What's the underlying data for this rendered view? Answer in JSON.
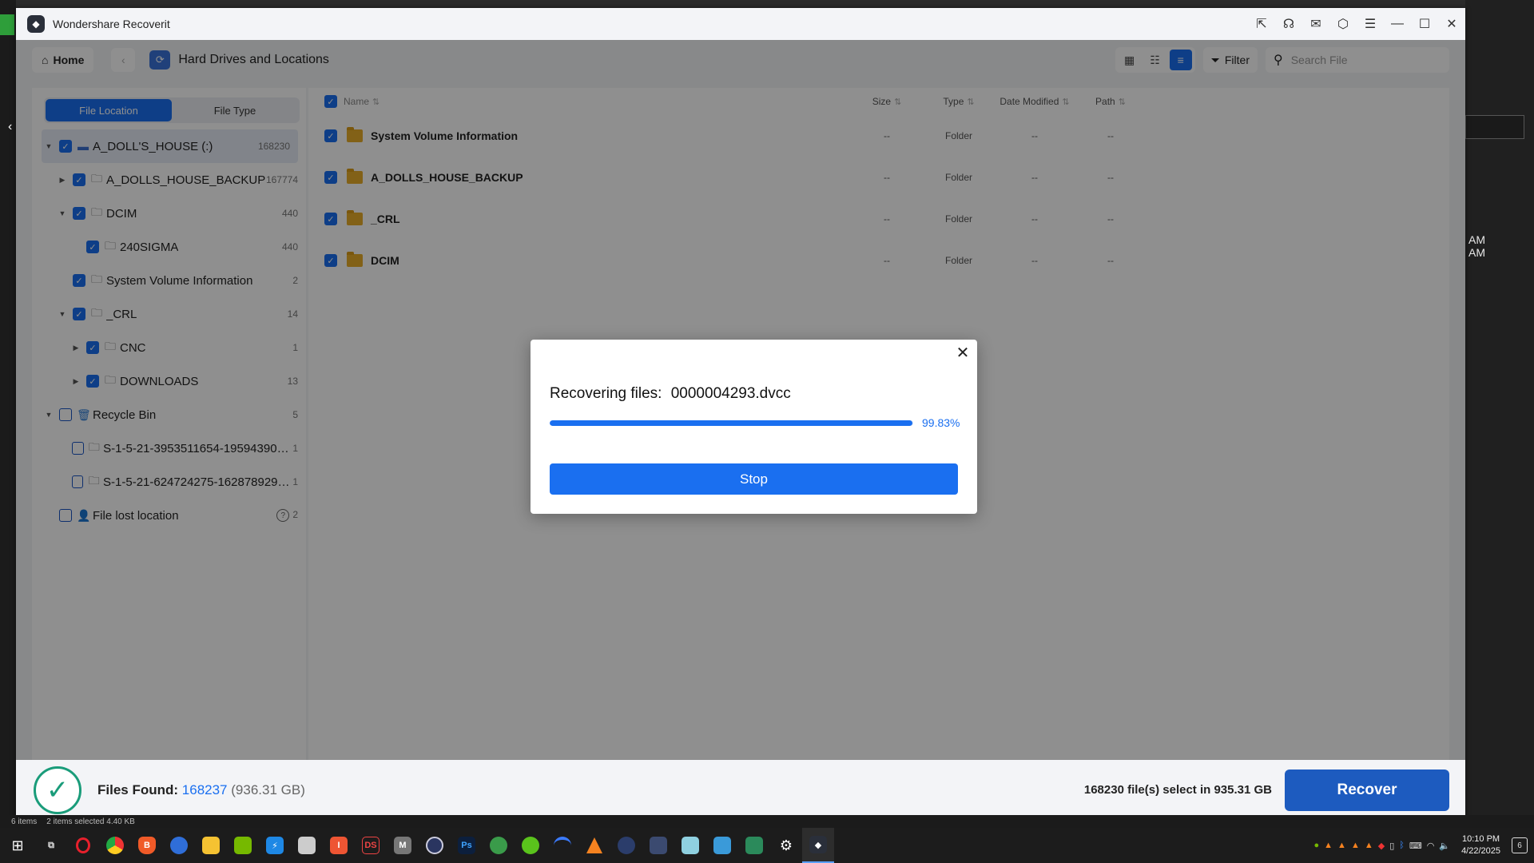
{
  "app": {
    "title": "Wondershare Recoverit",
    "title_icons": [
      "export-icon",
      "headset-icon",
      "mail-icon",
      "cube-icon",
      "menu-icon"
    ],
    "window_controls": [
      "minimize-icon",
      "maximize-icon",
      "close-icon"
    ]
  },
  "nav": {
    "home_label": "Home",
    "location_title": "Hard Drives and Locations",
    "filter_label": "Filter",
    "search_placeholder": "Search File"
  },
  "left": {
    "tabs": [
      {
        "label": "File Location",
        "active": true
      },
      {
        "label": "File Type",
        "active": false
      }
    ],
    "tree": [
      {
        "label": "A_DOLL'S_HOUSE (:)",
        "count": "168230",
        "level": 0,
        "caret": "down",
        "checked": true,
        "icon": "drive-icon",
        "selected": true
      },
      {
        "label": "A_DOLLS_HOUSE_BACKUP",
        "count": "167774",
        "level": 1,
        "caret": "right",
        "checked": true,
        "icon": "folder-icon"
      },
      {
        "label": "DCIM",
        "count": "440",
        "level": 1,
        "caret": "down",
        "checked": true,
        "icon": "folder-icon"
      },
      {
        "label": "240SIGMA",
        "count": "440",
        "level": 2,
        "caret": "",
        "checked": true,
        "icon": "folder-icon"
      },
      {
        "label": "System Volume Information",
        "count": "2",
        "level": 1,
        "caret": "",
        "checked": true,
        "icon": "folder-icon"
      },
      {
        "label": "_CRL",
        "count": "14",
        "level": 1,
        "caret": "down",
        "checked": true,
        "icon": "folder-icon"
      },
      {
        "label": "CNC",
        "count": "1",
        "level": 2,
        "caret": "right",
        "checked": true,
        "icon": "folder-icon"
      },
      {
        "label": "DOWNLOADS",
        "count": "13",
        "level": 2,
        "caret": "right",
        "checked": true,
        "icon": "folder-icon"
      },
      {
        "label": "Recycle Bin",
        "count": "5",
        "level": 0,
        "caret": "down",
        "checked": false,
        "icon": "recycle-bin-icon"
      },
      {
        "label": "S-1-5-21-3953511654-1959439042-4...",
        "count": "1",
        "level": 1,
        "caret": "",
        "checked": false,
        "icon": "folder-icon"
      },
      {
        "label": "S-1-5-21-624724275-1628789295-34...",
        "count": "1",
        "level": 1,
        "caret": "",
        "checked": false,
        "icon": "folder-icon"
      },
      {
        "label": "File lost location",
        "count": "2",
        "level": 0,
        "caret": "",
        "checked": false,
        "icon": "user-location-icon",
        "help": true
      }
    ]
  },
  "table": {
    "columns": [
      "Name",
      "Size",
      "Type",
      "Date Modified",
      "Path"
    ],
    "rows": [
      {
        "name": "System Volume Information",
        "size": "--",
        "type": "Folder",
        "date": "--",
        "path": "--"
      },
      {
        "name": "A_DOLLS_HOUSE_BACKUP",
        "size": "--",
        "type": "Folder",
        "date": "--",
        "path": "--"
      },
      {
        "name": "_CRL",
        "size": "--",
        "type": "Folder",
        "date": "--",
        "path": "--"
      },
      {
        "name": "DCIM",
        "size": "--",
        "type": "Folder",
        "date": "--",
        "path": "--"
      }
    ]
  },
  "bottom": {
    "found_label": "Files Found:",
    "found_count": "168237",
    "found_size": "(936.31 GB)",
    "selection": "168230 file(s) select in 935.31 GB",
    "recover_label": "Recover"
  },
  "modal": {
    "heading": "Recovering files:",
    "file": "0000004293.dvcc",
    "progress": 0.9983,
    "percent": "99.83%",
    "stop_label": "Stop"
  },
  "desktop": {
    "am1": "AM",
    "am2": "AM",
    "status_items": "6 items",
    "status_selected": "2 items selected  4.40 KB",
    "clock_time": "10:10 PM",
    "clock_date": "4/22/2025",
    "notifications": "6"
  },
  "colors": {
    "accent": "#1a6ff0",
    "recover": "#1d5bbf",
    "success": "#1a9c7a",
    "folder": "#e8ad2a"
  }
}
